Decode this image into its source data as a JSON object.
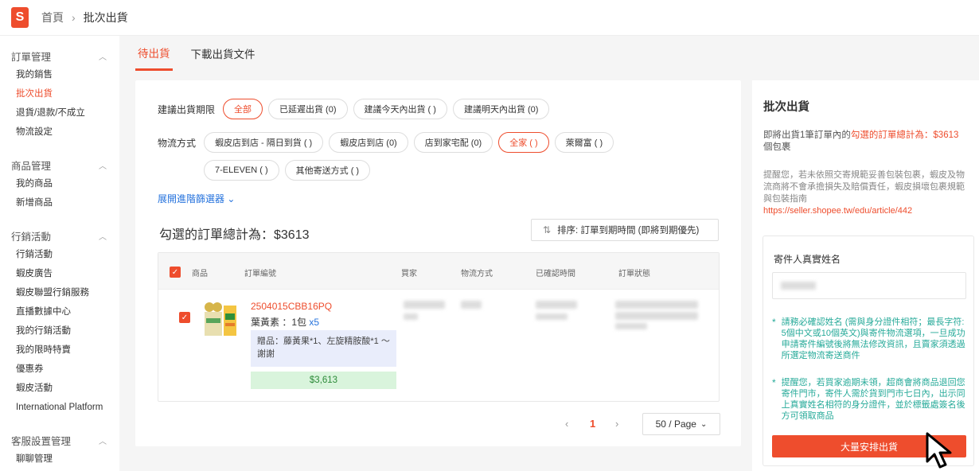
{
  "topbar": {
    "logo": "S",
    "home": "首頁",
    "separator": "›",
    "current": "批次出貨"
  },
  "sidebar": {
    "sections": [
      {
        "title": "訂單管理",
        "items": [
          "我的銷售",
          "批次出貨",
          "退貨/退款/不成立",
          "物流設定"
        ],
        "active": "批次出貨"
      },
      {
        "title": "商品管理",
        "items": [
          "我的商品",
          "新增商品"
        ]
      },
      {
        "title": "行銷活動",
        "items": [
          "行銷活動",
          "蝦皮廣告",
          "蝦皮聯盟行銷服務",
          "直播數據中心",
          "我的行銷活動",
          "我的限時特賣",
          "優惠券",
          "蝦皮活動",
          "International Platform"
        ]
      },
      {
        "title": "客服設置管理",
        "items": [
          "聊聊管理"
        ]
      }
    ]
  },
  "tabs": {
    "pending": "待出貨",
    "download": "下載出貨文件"
  },
  "filters": {
    "period_label": "建議出貨期限",
    "period_options": [
      "全部",
      "已延遲出貨 (0)",
      "建議今天內出貨 (    )",
      "建議明天內出貨 (0)"
    ],
    "period_active": "全部",
    "shipping_label": "物流方式",
    "shipping_options": [
      "蝦皮店到店 - 隔日到貨 (    )",
      "蝦皮店到店 (0)",
      "店到家宅配 (0)",
      "全家 (    )",
      "萊爾富 (    )",
      "7-ELEVEN (    )",
      "其他寄送方式 (    )"
    ],
    "shipping_active": "全家 (    )",
    "expand": "展開進階篩選器"
  },
  "summary": {
    "total_text": "勾選的訂單總計為：$3613",
    "sort_label": "排序: 訂單到期時間 (即將到期優先)"
  },
  "table": {
    "headers": [
      "商品",
      "訂單編號",
      "買家",
      "物流方式",
      "已確認時間",
      "訂單狀態"
    ],
    "row": {
      "order_id": "2504015CBB16PQ",
      "product": "葉黃素 ：1包",
      "qty": "x5",
      "gift": "贈品：藤黃果*1、左旋精胺酸*1 ～謝謝",
      "price": "$3,613"
    }
  },
  "pagination": {
    "prev": "‹",
    "current": "1",
    "next": "›",
    "page_size": "50 / Page"
  },
  "right_panel": {
    "title": "批次出貨",
    "summary_pre": "即將出貨1筆訂單內的",
    "summary_hl": "勾選的訂單總計為：$3613",
    "summary_post": "個包裹",
    "warning": "提醒您，若未依照交寄規範妥善包裝包裹，蝦皮及物流商將不會承擔損失及賠償責任，蝦皮損壞包裹規範與包裝指南",
    "warning_link": "https://seller.shopee.tw/edu/article/442",
    "sender_label": "寄件人真實姓名",
    "note1": "請務必確認姓名 (需與身分證件相符；最長字符: 5個中文或10個英文)與寄件物流選項，一旦成功申請寄件編號後將無法修改資訊，且賣家須透過所選定物流寄送商件",
    "note2": "提醒您，若買家逾期未領，超商會將商品退回您寄件門市，寄件人需於貨到門市七日內，出示同上真實姓名相符的身分證件，並於標籤處簽名後方可領取商品",
    "button": "大量安排出貨"
  },
  "colors": {
    "accent": "#ee4d2d",
    "link": "#2673dd",
    "note": "#26aa99"
  }
}
